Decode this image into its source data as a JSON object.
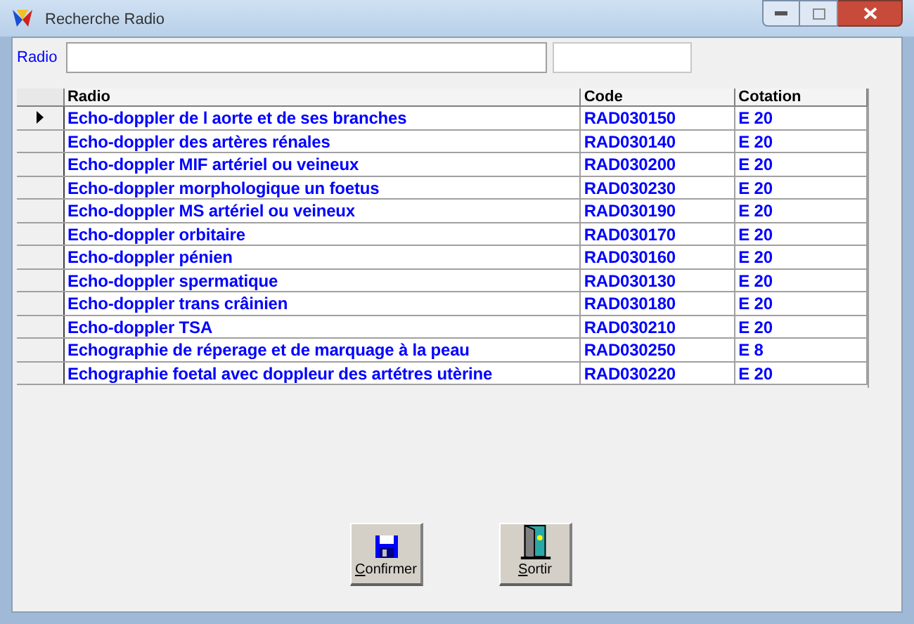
{
  "window": {
    "title": "Recherche Radio"
  },
  "search": {
    "label": "Radio"
  },
  "table": {
    "columns": [
      "Radio",
      "Code",
      "Cotation"
    ],
    "rows": [
      {
        "cells": [
          "Echo-doppler de l aorte  et de ses branches",
          "RAD030150",
          "E 20"
        ],
        "selected": true
      },
      {
        "cells": [
          "Echo-doppler des artères rénales",
          "RAD030140",
          "E 20"
        ],
        "selected": false
      },
      {
        "cells": [
          "Echo-doppler MIF artériel ou veineux",
          "RAD030200",
          "E 20"
        ],
        "selected": false
      },
      {
        "cells": [
          "Echo-doppler morphologique un foetus",
          "RAD030230",
          "E 20"
        ],
        "selected": false
      },
      {
        "cells": [
          "Echo-doppler MS artériel ou veineux",
          "RAD030190",
          "E 20"
        ],
        "selected": false
      },
      {
        "cells": [
          "Echo-doppler orbitaire",
          "RAD030170",
          "E 20"
        ],
        "selected": false
      },
      {
        "cells": [
          "Echo-doppler pénien",
          "RAD030160",
          "E 20"
        ],
        "selected": false
      },
      {
        "cells": [
          "Echo-doppler spermatique",
          "RAD030130",
          "E 20"
        ],
        "selected": false
      },
      {
        "cells": [
          "Echo-doppler trans crâinien",
          "RAD030180",
          "E 20"
        ],
        "selected": false
      },
      {
        "cells": [
          "Echo-doppler TSA",
          "RAD030210",
          "E 20"
        ],
        "selected": false
      },
      {
        "cells": [
          "Echographie de réperage et de marquage à la peau",
          "RAD030250",
          "E 8"
        ],
        "selected": false
      },
      {
        "cells": [
          "Echographie foetal avec doppleur des artétres utèrine",
          "RAD030220",
          "E 20"
        ],
        "selected": false
      }
    ]
  },
  "buttons": [
    {
      "kind": "save",
      "label": "Confirmer"
    },
    {
      "kind": "exit",
      "label": "Sortir"
    }
  ]
}
